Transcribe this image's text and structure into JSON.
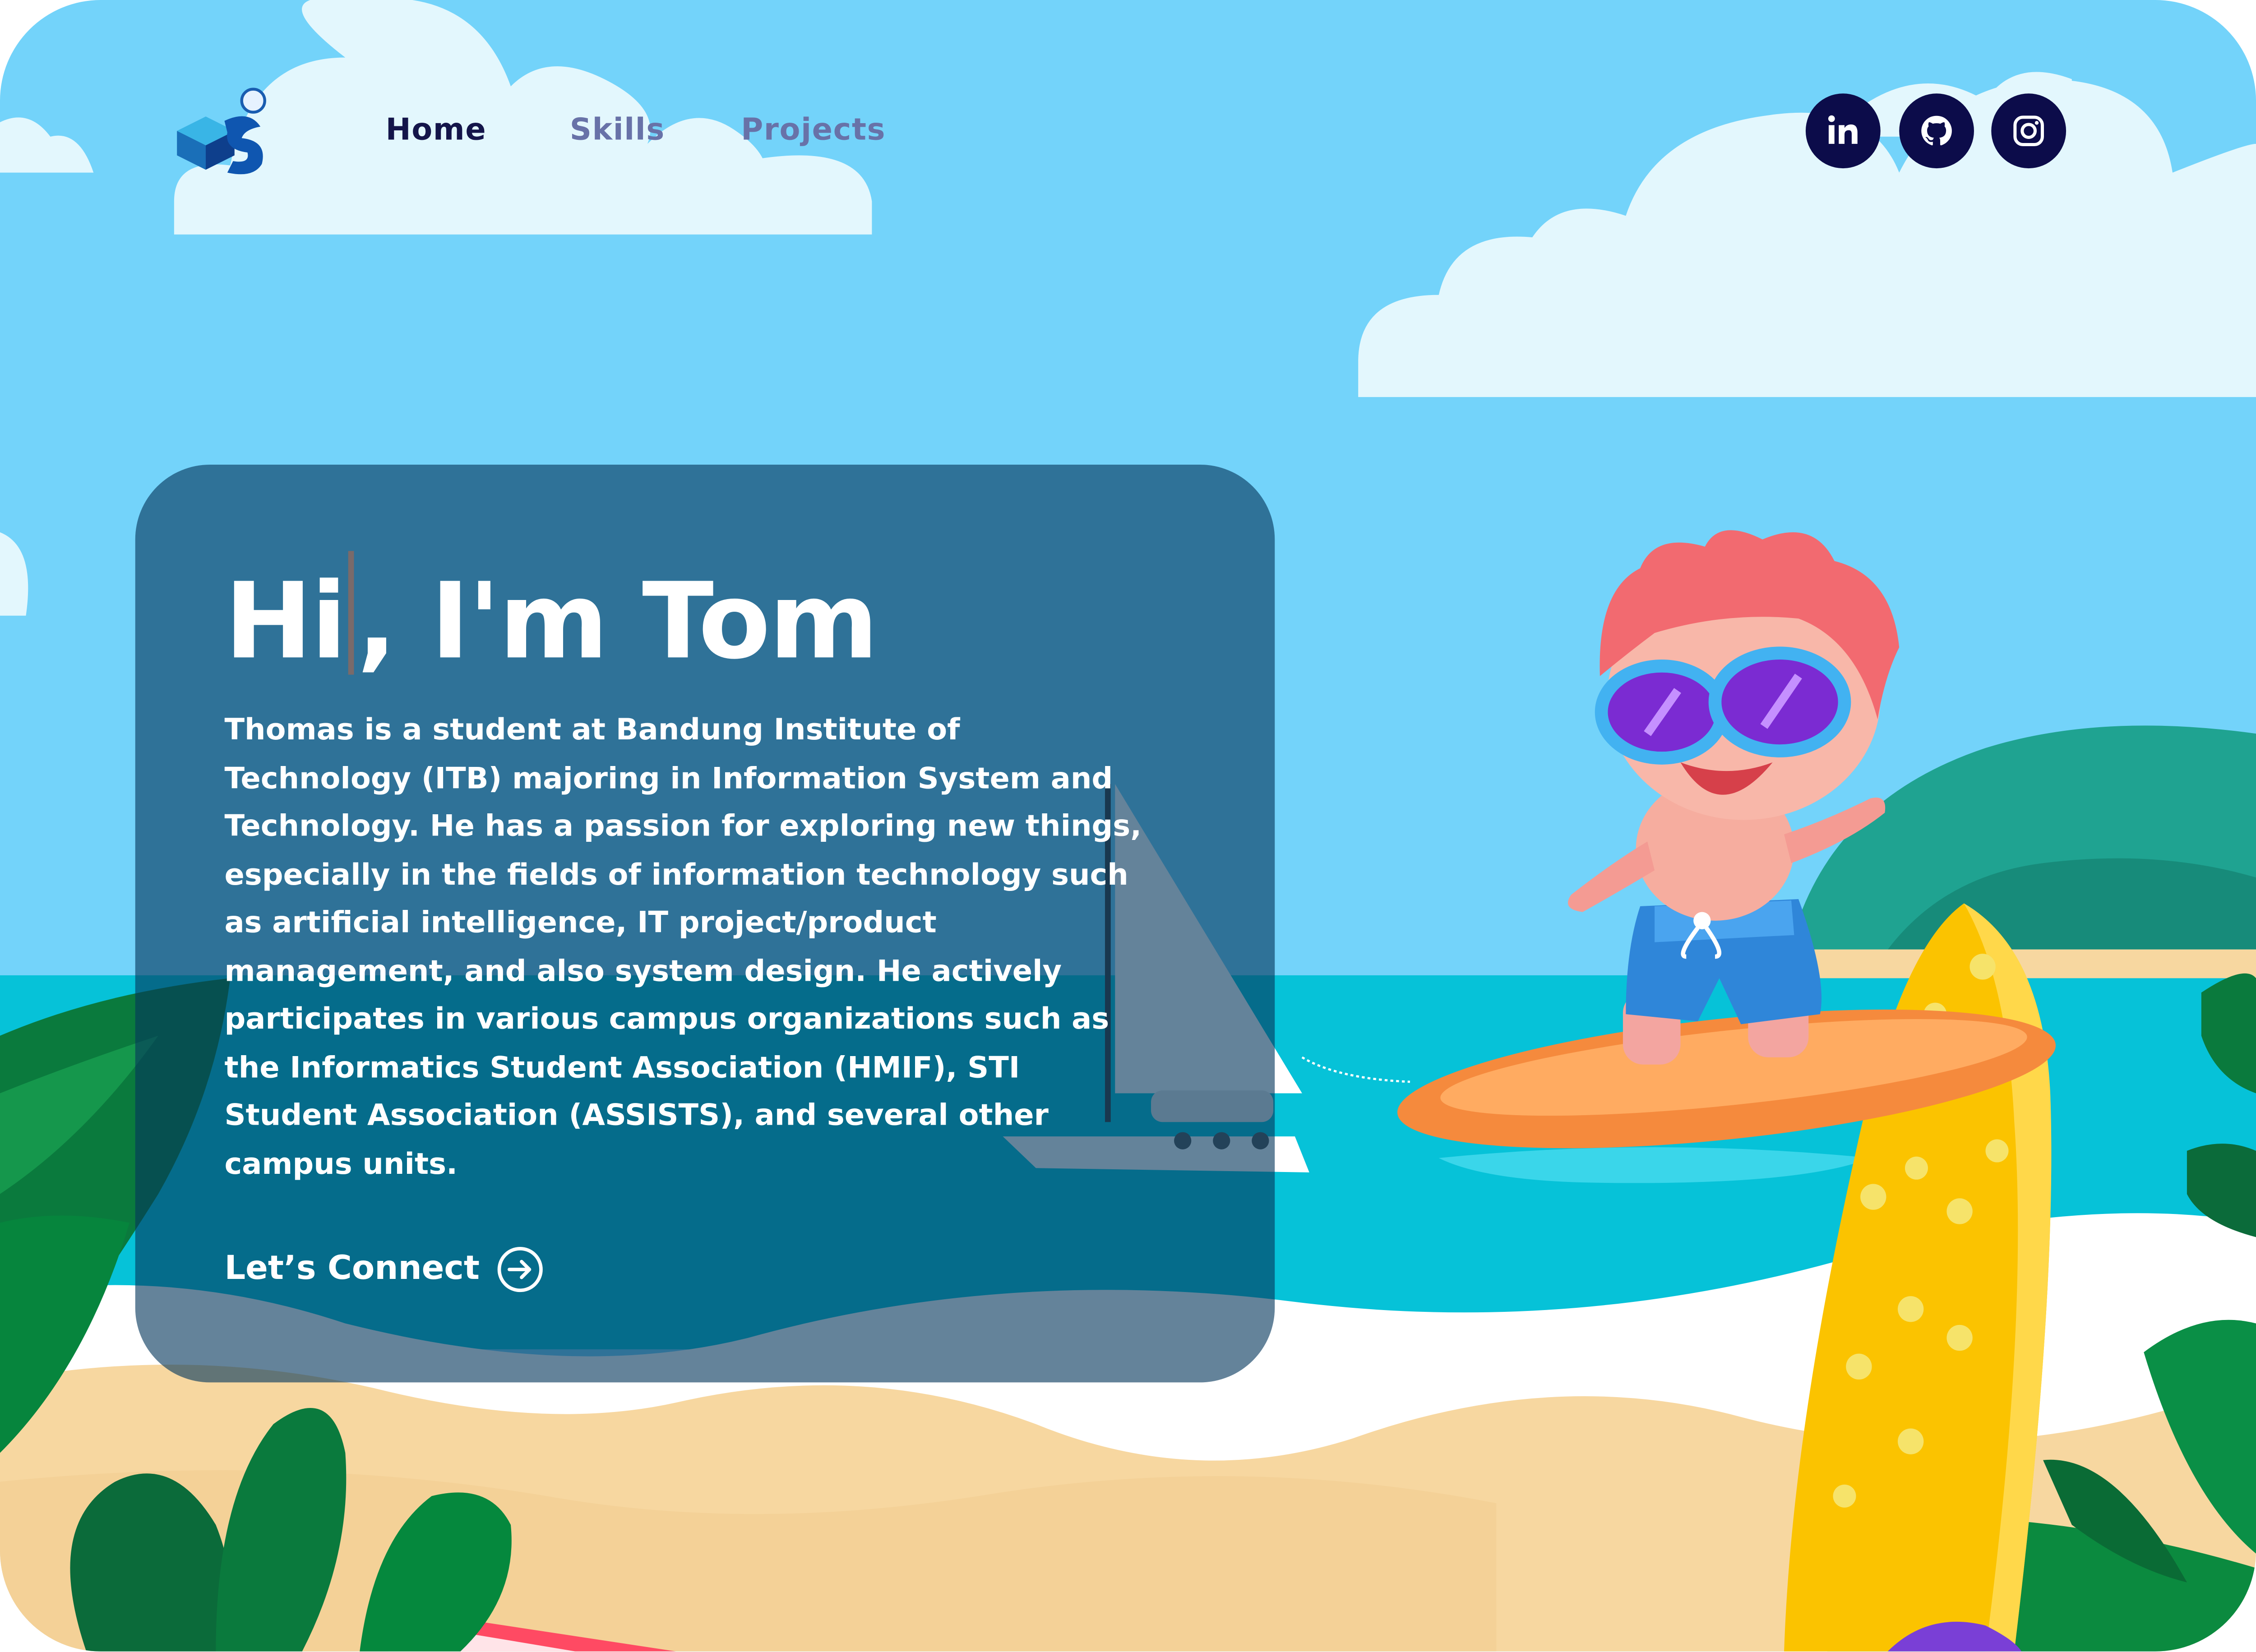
{
  "nav": {
    "links": [
      {
        "label": "Home",
        "active": true
      },
      {
        "label": "Skills",
        "active": false
      },
      {
        "label": "Projects",
        "active": false
      }
    ]
  },
  "social": [
    {
      "name": "linkedin",
      "icon": "linkedin-icon",
      "glyph": "in"
    },
    {
      "name": "github",
      "icon": "github-icon"
    },
    {
      "name": "instagram",
      "icon": "instagram-icon"
    }
  ],
  "hero": {
    "greeting_part1": "Hi",
    "greeting_part2": ", I'm Tom",
    "bio": "Thomas is a student at Bandung Institute of Technology (ITB) majoring in Information System and Technology. He has a passion for exploring new things, especially in the fields of information technology such as artificial intelligence, IT project/product management, and also system design. He actively participates in various campus organizations such as the Informatics Student Association (HMIF), STI Student Association (ASSISTS), and several other campus units.",
    "cta_label": "Let’s Connect",
    "cta_icon": "arrow-circle-right-icon"
  },
  "colors": {
    "sky": "#73d3fa",
    "cloud": "#e3f7fd",
    "sea": "#06c2d8",
    "sand": "#f7d7a0",
    "nav_active": "#14154a",
    "nav_inactive": "#6872a8",
    "social_bg": "#0c0c4a",
    "card": "rgba(5,55,92,0.62)",
    "text": "#ffffff"
  }
}
